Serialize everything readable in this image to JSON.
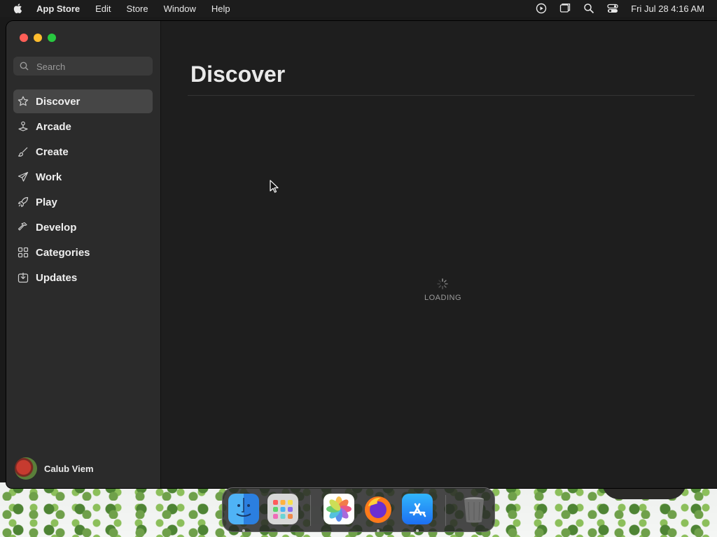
{
  "menubar": {
    "app_name": "App Store",
    "menus": [
      "Edit",
      "Store",
      "Window",
      "Help"
    ],
    "datetime": "Fri Jul 28  4:16 AM",
    "status_icons": [
      "screen-recording-icon",
      "window-icon",
      "search-icon",
      "control-center-icon"
    ]
  },
  "sidebar": {
    "search_placeholder": "Search",
    "items": [
      {
        "label": "Discover",
        "icon": "star-icon",
        "active": true
      },
      {
        "label": "Arcade",
        "icon": "joystick-icon",
        "active": false
      },
      {
        "label": "Create",
        "icon": "brush-icon",
        "active": false
      },
      {
        "label": "Work",
        "icon": "paper-plane-icon",
        "active": false
      },
      {
        "label": "Play",
        "icon": "rocket-icon",
        "active": false
      },
      {
        "label": "Develop",
        "icon": "hammer-icon",
        "active": false
      },
      {
        "label": "Categories",
        "icon": "grid-icon",
        "active": false
      },
      {
        "label": "Updates",
        "icon": "download-icon",
        "active": false
      }
    ],
    "user_name": "Calub Viem"
  },
  "main": {
    "title": "Discover",
    "loading_text": "LOADING"
  },
  "dock": {
    "apps": [
      {
        "name": "finder-icon",
        "running": true
      },
      {
        "name": "launchpad-icon",
        "running": false
      },
      {
        "name": "photos-icon",
        "running": false
      },
      {
        "name": "firefox-icon",
        "running": true
      },
      {
        "name": "app-store-icon",
        "running": true
      },
      {
        "name": "trash-icon",
        "running": false
      }
    ]
  },
  "colors": {
    "close": "#ff5f57",
    "minimize": "#febc2e",
    "maximize": "#28c840",
    "active_nav": "#464646"
  }
}
